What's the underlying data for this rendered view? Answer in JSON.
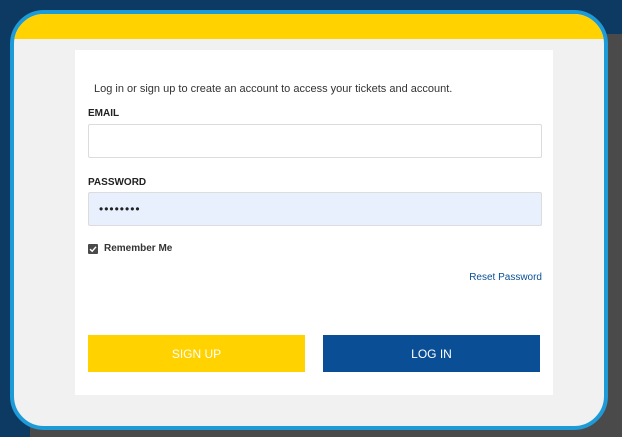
{
  "intro": "Log in or sign up to create an account to access your tickets and account.",
  "email": {
    "label": "EMAIL",
    "value": ""
  },
  "password": {
    "label": "PASSWORD",
    "value": "••••••••"
  },
  "remember": {
    "label": "Remember Me",
    "checked": true
  },
  "reset_link": "Reset Password",
  "buttons": {
    "signup": "SIGN UP",
    "login": "LOG IN"
  },
  "colors": {
    "yellow": "#ffd200",
    "blue": "#0a4f96",
    "frame": "#1d9bd8"
  }
}
